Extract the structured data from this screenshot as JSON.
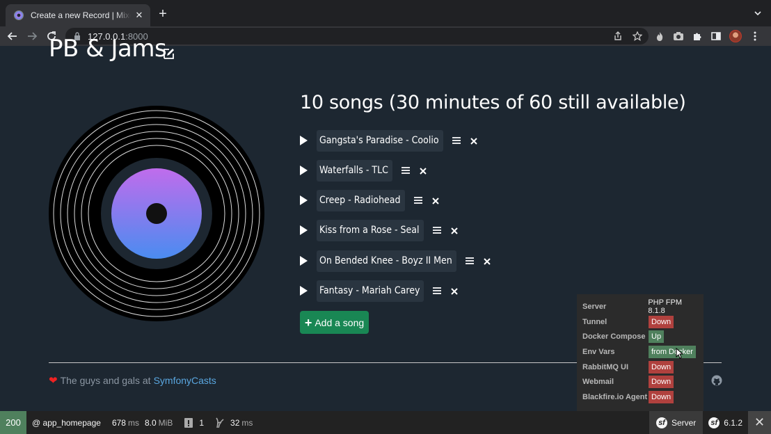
{
  "browser": {
    "tab_title": "Create a new Record | Mixed Vinyl",
    "url_host": "127.0.0.1",
    "url_port": ":8000"
  },
  "page": {
    "title": "PB & Jams",
    "songs_heading": "10 songs (30 minutes of 60 still available)",
    "songs": [
      "Gangsta's Paradise - Coolio",
      "Waterfalls - TLC",
      "Creep - Radiohead",
      "Kiss from a Rose - Seal",
      "On Bended Knee - Boyz II Men",
      "Fantasy - Mariah Carey"
    ],
    "add_button": "Add a song",
    "footer_text": "The guys and gals at",
    "footer_link": "SymfonyCasts"
  },
  "server_panel": {
    "rows": [
      {
        "label": "Server",
        "value": "PHP FPM 8.1.8",
        "status": "none"
      },
      {
        "label": "Tunnel",
        "value": "Down",
        "status": "red"
      },
      {
        "label": "Docker Compose",
        "value": "Up",
        "status": "green"
      },
      {
        "label": "Env Vars",
        "value": "from Docker",
        "status": "green"
      },
      {
        "label": "RabbitMQ UI",
        "value": "Down",
        "status": "red"
      },
      {
        "label": "Webmail",
        "value": "Down",
        "status": "red"
      },
      {
        "label": "Blackfire.io Agent",
        "value": "Down",
        "status": "red"
      }
    ]
  },
  "debug_toolbar": {
    "status_code": "200",
    "route": "@ app_homepage",
    "time_value": "678",
    "time_unit": "ms",
    "memory_value": "8.0",
    "memory_unit": "MiB",
    "log_count": "1",
    "twig_value": "32",
    "twig_unit": "ms",
    "server_label": "Server",
    "version": "6.1.2"
  },
  "colors": {
    "page_bg": "#1d2731",
    "add_button": "#198754",
    "status_ok": "#4f805d",
    "status_down": "#b0413e"
  }
}
